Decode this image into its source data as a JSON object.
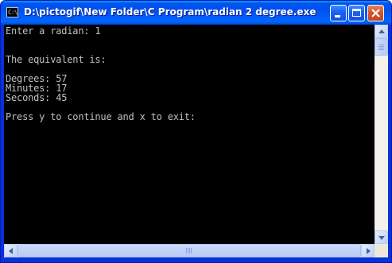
{
  "window": {
    "title": "D:\\pictogif\\New Folder\\C Program\\radian 2 degree.exe",
    "icon": "console-icon",
    "icon_text": "C:\\"
  },
  "controls": {
    "minimize_icon": "minimize-icon",
    "maximize_icon": "maximize-icon",
    "close_icon": "close-icon"
  },
  "console": {
    "lines": [
      "Enter a radian: 1",
      "",
      "",
      "The equivalent is:",
      "",
      "Degrees: 57",
      "Minutes: 17",
      "Seconds: 45",
      "",
      "Press y to continue and x to exit:"
    ],
    "background": "#000000",
    "foreground": "#c0c0c0"
  },
  "colors": {
    "titlebar": "#0053ee",
    "close_button": "#d5532b"
  }
}
